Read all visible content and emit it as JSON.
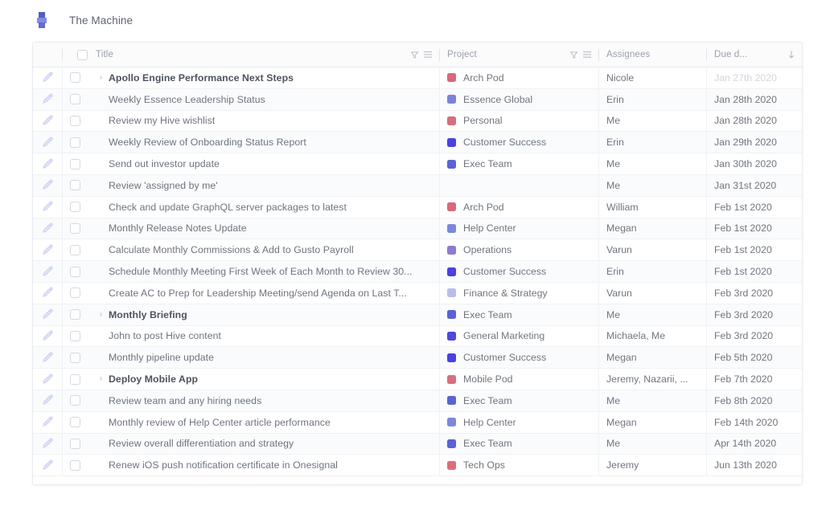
{
  "app": {
    "board_title": "The Machine",
    "logo_icon": "hive-logo-icon"
  },
  "table": {
    "columns": [
      {
        "key": "title",
        "label": "Title",
        "filter_icon": "funnel-icon",
        "menu_icon": "list-menu-icon",
        "sort_icon": ""
      },
      {
        "key": "project",
        "label": "Project",
        "filter_icon": "funnel-icon",
        "menu_icon": "list-menu-icon",
        "sort_icon": ""
      },
      {
        "key": "assignee",
        "label": "Assignees",
        "filter_icon": "",
        "menu_icon": "",
        "sort_icon": ""
      },
      {
        "key": "due",
        "label": "Due d...",
        "filter_icon": "",
        "menu_icon": "",
        "sort_icon": "sort-desc-arrow-icon"
      }
    ],
    "header_checkbox_checked": false,
    "project_colors": {
      "Arch Pod": "#d9687a",
      "Essence Global": "#7b84d8",
      "Personal": "#d66f7c",
      "Customer Success": "#4a41e0",
      "Exec Team": "#5a63d4",
      "Help Center": "#7d87dd",
      "Operations": "#8e7ad0",
      "Finance & Strategy": "#b9bee8",
      "General Marketing": "#4f47de",
      "Mobile Pod": "#d96f7c",
      "Tech Ops": "#dd6e7c"
    },
    "rows": [
      {
        "title": "Apollo Engine Performance Next Steps",
        "parent": true,
        "expandable": true,
        "project": "Arch Pod",
        "assignee": "Nicole",
        "due": "Jan 27th 2020",
        "due_past": true
      },
      {
        "title": "Weekly Essence Leadership Status",
        "parent": false,
        "expandable": false,
        "project": "Essence Global",
        "assignee": "Erin",
        "due": "Jan 28th 2020",
        "due_past": false
      },
      {
        "title": "Review my Hive wishlist",
        "parent": false,
        "expandable": false,
        "project": "Personal",
        "assignee": "Me",
        "due": "Jan 28th 2020",
        "due_past": false
      },
      {
        "title": "Weekly Review of Onboarding Status Report",
        "parent": false,
        "expandable": false,
        "project": "Customer Success",
        "assignee": "Erin",
        "due": "Jan 29th 2020",
        "due_past": false
      },
      {
        "title": "Send out investor update",
        "parent": false,
        "expandable": false,
        "project": "Exec Team",
        "assignee": "Me",
        "due": "Jan 30th 2020",
        "due_past": false
      },
      {
        "title": "Review 'assigned by me'",
        "parent": false,
        "expandable": false,
        "project": "",
        "assignee": "Me",
        "due": "Jan 31st 2020",
        "due_past": false
      },
      {
        "title": "Check and update GraphQL server packages to latest",
        "parent": false,
        "expandable": false,
        "project": "Arch Pod",
        "assignee": "William",
        "due": "Feb 1st 2020",
        "due_past": false
      },
      {
        "title": "Monthly Release Notes Update",
        "parent": false,
        "expandable": false,
        "project": "Help Center",
        "assignee": "Megan",
        "due": "Feb 1st 2020",
        "due_past": false
      },
      {
        "title": "Calculate Monthly Commissions & Add to Gusto Payroll",
        "parent": false,
        "expandable": false,
        "project": "Operations",
        "assignee": "Varun",
        "due": "Feb 1st 2020",
        "due_past": false
      },
      {
        "title": "Schedule Monthly Meeting First Week of Each Month to Review 30...",
        "parent": false,
        "expandable": false,
        "project": "Customer Success",
        "assignee": "Erin",
        "due": "Feb 1st 2020",
        "due_past": false
      },
      {
        "title": "Create AC to Prep for Leadership Meeting/send Agenda on Last T...",
        "parent": false,
        "expandable": false,
        "project": "Finance & Strategy",
        "assignee": "Varun",
        "due": "Feb 3rd 2020",
        "due_past": false
      },
      {
        "title": "Monthly Briefing",
        "parent": true,
        "expandable": true,
        "project": "Exec Team",
        "assignee": "Me",
        "due": "Feb 3rd 2020",
        "due_past": false
      },
      {
        "title": "John to post Hive content",
        "parent": false,
        "expandable": false,
        "project": "General Marketing",
        "assignee": "Michaela, Me",
        "due": "Feb 3rd 2020",
        "due_past": false
      },
      {
        "title": "Monthly pipeline update",
        "parent": false,
        "expandable": false,
        "project": "Customer Success",
        "assignee": "Megan",
        "due": "Feb 5th 2020",
        "due_past": false
      },
      {
        "title": "Deploy Mobile App",
        "parent": true,
        "expandable": true,
        "project": "Mobile Pod",
        "assignee": "Jeremy, Nazarii, ...",
        "due": "Feb 7th 2020",
        "due_past": false
      },
      {
        "title": "Review team and any hiring needs",
        "parent": false,
        "expandable": false,
        "project": "Exec Team",
        "assignee": "Me",
        "due": "Feb 8th 2020",
        "due_past": false
      },
      {
        "title": "Monthly review of Help Center article performance",
        "parent": false,
        "expandable": false,
        "project": "Help Center",
        "assignee": "Megan",
        "due": "Feb 14th 2020",
        "due_past": false
      },
      {
        "title": "Review overall differentiation and strategy",
        "parent": false,
        "expandable": false,
        "project": "Exec Team",
        "assignee": "Me",
        "due": "Apr 14th 2020",
        "due_past": false
      },
      {
        "title": "Renew iOS push notification certificate in Onesignal",
        "parent": false,
        "expandable": false,
        "project": "Tech Ops",
        "assignee": "Jeremy",
        "due": "Jun 13th 2020",
        "due_past": false
      }
    ]
  }
}
